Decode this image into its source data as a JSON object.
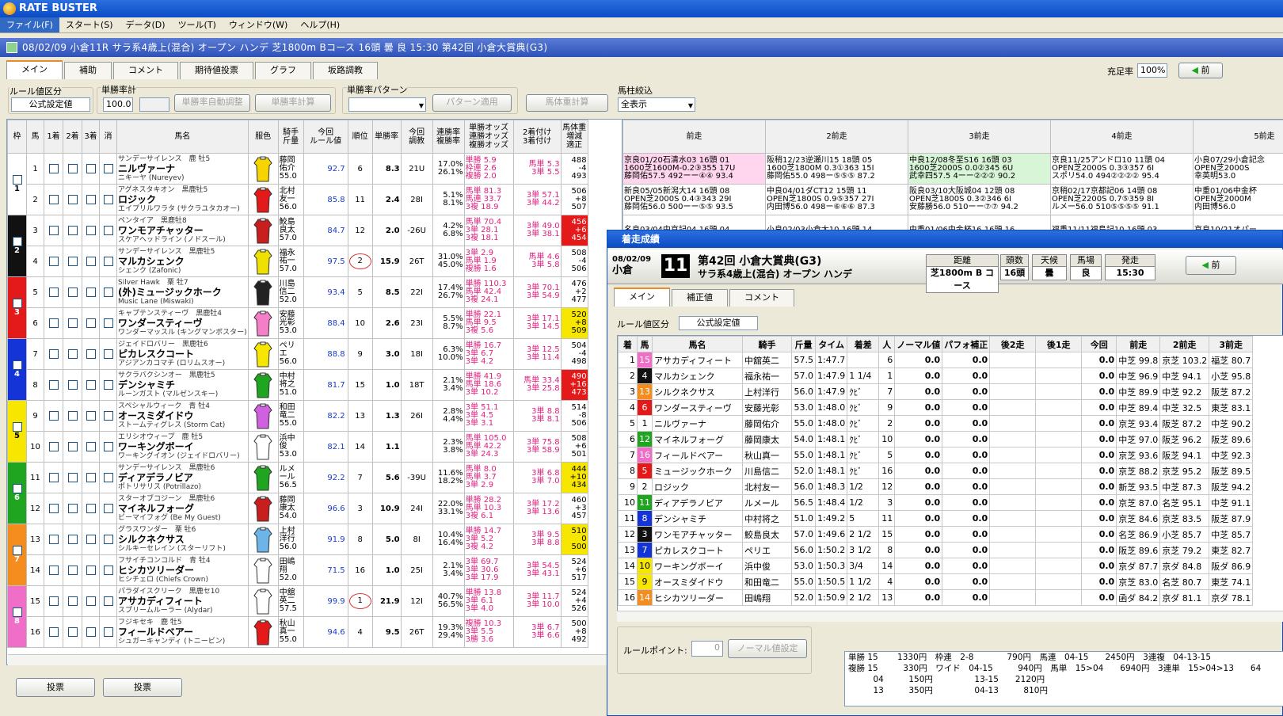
{
  "app_title": "RATE BUSTER",
  "menu": [
    "ファイル(F)",
    "スタート(S)",
    "データ(D)",
    "ツール(T)",
    "ウィンドウ(W)",
    "ヘルプ(H)"
  ],
  "race_header": "08/02/09 小倉11R サラ系4歳上(混合) オープン ハンデ 芝1800m Bコース 16頭 曇 良 15:30 第42回 小倉大賞典(G3)",
  "tabs": [
    "メイン",
    "補助",
    "コメント",
    "期待値投票",
    "グラフ",
    "坂路調教"
  ],
  "top_right": {
    "label": "充足率",
    "value": "100%",
    "prev": "前"
  },
  "controls": {
    "rule_label": "ルール値区分",
    "rule_value": "公式設定値",
    "win_rate_label": "単勝率計",
    "win_rate_value": "100.0",
    "auto_adjust": "単勝率自動調整",
    "calc": "単勝率計算",
    "pattern_label": "単勝率パターン",
    "pattern_apply": "パターン適用",
    "weight_calc": "馬体重計算",
    "filter_label": "馬柱絞込",
    "filter_value": "全表示"
  },
  "headers": [
    "枠",
    "馬",
    "1着",
    "2着",
    "3着",
    "消",
    "馬名",
    "服色",
    "騎手\n斤量",
    "今回\nルール値",
    "順位",
    "単勝率",
    "今回\n調教",
    "連勝率\n複勝率",
    "単勝オッズ\n連勝オッズ\n複勝オッズ",
    "2着付け\n3着付け",
    "馬体重\n増減\n適正",
    "前走",
    "2前走",
    "3前走",
    "4前走",
    "5前走"
  ],
  "horses": [
    {
      "frame": "1",
      "fcolor": "#ffffff",
      "fc": "#000",
      "no": "1",
      "sire": "サンデーサイレンス　鹿 牡5",
      "name": "ニルヴァーナ",
      "dam": "ニキーヤ (Nureyev)",
      "jockey": "藤岡\n佑介\n55.0",
      "rate": "92.7",
      "rank": "6",
      "odds": "8.3",
      "train": "21U",
      "pct": "17.0%\n26.1%",
      "bet": "単勝 5.9\n枠連 2.6\n複勝 2.0",
      "two": "馬単 5.3\n3単 5.5",
      "wt": "488\n-4\n493",
      "p1": "京良01/20石清水03 16頭 01\n1600芝1600M-0.2③355 17U\n藤岡佑57.5 492ーー④④ 93.4",
      "p1c": "#ffd6ee",
      "p2": "阪稍12/23逆瀬川15 18頭 05\n1600芝1800M 0.3①363 15I\n藤岡佑55.0 498ー⑤⑤⑤ 87.2",
      "p3": "中良12/08冬至S16 16頭 03\n1600芝2000S 0.0②345 6U\n武幸四57.5 4ーー②②② 90.2",
      "p3c": "#d8f5d8",
      "p4": "京良11/25アンドロ10 11頭 04\nOPEN芝2000S 0.3③357 6I\nスポリ54.0 494②②②② 95.4",
      "p5": "小良07/29小倉記念\nOPEN芝2000S\n幸英明53.0"
    },
    {
      "frame": "",
      "fcolor": "#ffffff",
      "fc": "#000",
      "no": "2",
      "sire": "アグネスタキオン　黒鹿牡5",
      "name": "ロジック",
      "dam": "エイプリルワラタ (サクラユタカオー)",
      "jockey": "北村\n友一\n56.0",
      "rate": "85.8",
      "rank": "11",
      "odds": "2.4",
      "train": "28I",
      "pct": "5.1%\n8.1%",
      "bet": "馬単 81.3\n馬連 33.7\n3複 18.9",
      "two": "3単 57.1\n3単 44.2",
      "wt": "506\n+8\n507",
      "p1": "新良05/05新潟大14 16頭 08\nOPEN芝2000S 0.4③343 29I\n藤岡佑56.0 500ーー⑤⑤ 93.5",
      "p1c": "#fff",
      "p2": "中良04/01ダCT12 15頭 11\nOPEN芝1800S 0.9⑤357 27I\n内田博56.0 498ー⑥⑥⑥ 87.3",
      "p3": "阪良03/10大阪城04 12頭 08\nOPEN芝1800S 0.3②346 6I\n安藤勝56.0 510ーー⑦⑦ 94.2",
      "p3c": "#fff",
      "p4": "京稍02/17京都記06 14頭 08\nOPEN芝2200S 0.7⑤359 8I\nルメー56.0 510⑤⑤⑤⑤ 91.1",
      "p5": "中重01/06中金杯\nOPEN芝2000M\n内田博56.0"
    },
    {
      "frame": "2",
      "fcolor": "#111111",
      "fc": "#fff",
      "no": "3",
      "sire": "ペンタイア　黒鹿牡8",
      "name": "ワンモアチャッター",
      "dam": "スケアヘッドライン (ノドスール)",
      "jockey": "鮫島\n良太\n57.0",
      "rate": "84.7",
      "rank": "12",
      "odds": "2.0",
      "train": "-26U",
      "pct": "4.2%\n6.8%",
      "bet": "馬単 70.4\n3単 28.1\n3複 18.1",
      "two": "3単 49.0\n3単 38.1",
      "wt": "456\n+6\n454",
      "p1": "名良03/04中京記04 16頭 04",
      "p1c": "#fff",
      "p2": "小良02/03小倉大10 16頭 14",
      "p3": "中重01/06中金杯16 16頭 16",
      "p3c": "#fff",
      "p4": "福重11/11福島記10 16頭 03",
      "p5": "京良10/21オパー"
    },
    {
      "frame": "",
      "fcolor": "#111111",
      "fc": "#fff",
      "no": "4",
      "sire": "サンデーサイレンス　黒鹿牡5",
      "name": "マルカシェンク",
      "dam": "シェンク (Zafonic)",
      "jockey": "福永\n祐一\n57.0",
      "rate": "97.5",
      "rank": "2",
      "odds": "15.9",
      "train": "26T",
      "pct": "31.0%\n45.0%",
      "bet": "3単 2.9\n馬単 1.9\n複勝 1.6",
      "two": "馬単 4.6\n3単 5.8",
      "wt": "508\n-4\n506",
      "p1": "",
      "p1c": "#fff",
      "p2": "",
      "p3": "",
      "p3c": "#fff",
      "p4": "",
      "p5": ""
    },
    {
      "frame": "3",
      "fcolor": "#e41a1a",
      "fc": "#fff",
      "no": "5",
      "sire": "Silver Hawk　栗 牡7",
      "name": "(外)ミュージックホーク",
      "dam": "Music Lane (Miswaki)",
      "jockey": "川島\n信二\n52.0",
      "rate": "93.4",
      "rank": "5",
      "odds": "8.5",
      "train": "22I",
      "pct": "17.4%\n26.7%",
      "bet": "単勝 110.3\n馬単 42.4\n3複 24.1",
      "two": "3単 70.1\n3単 54.9",
      "wt": "476\n+2\n477",
      "p1": "",
      "p1c": "#fff",
      "p2": "",
      "p3": "",
      "p3c": "#fff",
      "p4": "",
      "p5": ""
    },
    {
      "frame": "",
      "fcolor": "#e41a1a",
      "fc": "#fff",
      "no": "6",
      "sire": "キャプテンスティーヴ　黒鹿牡4",
      "name": "ワンダースティーヴ",
      "dam": "ワンダーマッスル (キングマンボスター)",
      "jockey": "安藤\n光彰\n53.0",
      "rate": "88.4",
      "rank": "10",
      "odds": "2.6",
      "train": "23I",
      "pct": "5.5%\n8.7%",
      "bet": "単勝 22.1\n馬単 9.5\n3複 5.6",
      "two": "3単 17.1\n3単 14.5",
      "wt": "520\n+8\n509",
      "p1": "",
      "p1c": "#fff",
      "p2": "",
      "p3": "",
      "p3c": "#fff",
      "p4": "",
      "p5": ""
    },
    {
      "frame": "4",
      "fcolor": "#1534d8",
      "fc": "#fff",
      "no": "7",
      "sire": "ジェイドロバリー　黒鹿牡6",
      "name": "ピカレスクコート",
      "dam": "アジアンカコマチ (ロリムスオー)",
      "jockey": "ペリ\nエ\n56.0",
      "rate": "88.8",
      "rank": "9",
      "odds": "3.0",
      "train": "18I",
      "pct": "6.3%\n10.0%",
      "bet": "単勝 16.7\n3単 6.7\n3単 4.2",
      "two": "3単 12.5\n3単 11.4",
      "wt": "504\n-4\n498",
      "p1": "",
      "p1c": "#fff",
      "p2": "",
      "p3": "",
      "p3c": "#fff",
      "p4": "",
      "p5": ""
    },
    {
      "frame": "",
      "fcolor": "#1534d8",
      "fc": "#fff",
      "no": "8",
      "sire": "サクラバクシンオー　黒鹿牡5",
      "name": "デンシャミチ",
      "dam": "ルーンガスト (マルゼンスキー)",
      "jockey": "中村\n将之\n51.0",
      "rate": "81.7",
      "rank": "15",
      "odds": "1.0",
      "train": "18T",
      "pct": "2.1%\n3.4%",
      "bet": "単勝 41.9\n馬単 18.6\n3単 10.2",
      "two": "馬単 33.4\n3単 25.8",
      "wt": "490\n+16\n473",
      "p1": "",
      "p1c": "#fff",
      "p2": "",
      "p3": "",
      "p3c": "#fff",
      "p4": "",
      "p5": ""
    },
    {
      "frame": "5",
      "fcolor": "#f7e600",
      "fc": "#000",
      "no": "9",
      "sire": "スペシャルウィーク　青 牡4",
      "name": "オースミダイドウ",
      "dam": "ストームティグレス (Storm Cat)",
      "jockey": "和田\n竜二\n55.0",
      "rate": "82.2",
      "rank": "13",
      "odds": "1.3",
      "train": "26I",
      "pct": "2.8%\n4.4%",
      "bet": "3単 51.1\n3単 4.5\n3単 3.1",
      "two": "3単 8.8\n3単 8.1",
      "wt": "514\n-8\n506",
      "p1": "",
      "p1c": "#fff",
      "p2": "",
      "p3": "",
      "p3c": "#fff",
      "p4": "",
      "p5": ""
    },
    {
      "frame": "",
      "fcolor": "#f7e600",
      "fc": "#000",
      "no": "10",
      "sire": "エリシオウィープ　鹿 牡5",
      "name": "ワーキングボーイ",
      "dam": "ワーキングイオン (ジェイドロバリー)",
      "jockey": "浜中\n俊\n53.0",
      "rate": "82.1",
      "rank": "14",
      "odds": "1.1",
      "train": "",
      "pct": "2.3%\n3.8%",
      "bet": "馬単 105.0\n馬単 42.2\n3単 24.3",
      "two": "3単 75.8\n3単 58.9",
      "wt": "508\n+6\n501",
      "p1": "",
      "p1c": "#fff",
      "p2": "",
      "p3": "",
      "p3c": "#fff",
      "p4": "",
      "p5": ""
    },
    {
      "frame": "6",
      "fcolor": "#1fa51f",
      "fc": "#fff",
      "no": "11",
      "sire": "サンデーサイレンス　黒鹿牡6",
      "name": "ディアデラノビア",
      "dam": "ポトリサリス (Potrillazo)",
      "jockey": "ルメ\nール\n56.5",
      "rate": "92.2",
      "rank": "7",
      "odds": "5.6",
      "train": "-39U",
      "pct": "11.6%\n18.2%",
      "bet": "馬単 8.0\n馬単 3.7\n3単 2.9",
      "two": "3単 6.8\n3単 7.0",
      "wt": "444\n+10\n434",
      "p1": "",
      "p1c": "#fff",
      "p2": "",
      "p3": "",
      "p3c": "#fff",
      "p4": "",
      "p5": ""
    },
    {
      "frame": "",
      "fcolor": "#1fa51f",
      "fc": "#fff",
      "no": "12",
      "sire": "スターオブコジーン　黒鹿牡6",
      "name": "マイネルフォーグ",
      "dam": "ビーマイフォグ (Be My Guest)",
      "jockey": "藤岡\n康太\n54.0",
      "rate": "96.6",
      "rank": "3",
      "odds": "10.9",
      "train": "24I",
      "pct": "22.0%\n33.1%",
      "bet": "単勝 28.2\n馬単 10.3\n3複 6.1",
      "two": "3単 17.2\n3単 13.6",
      "wt": "460\n+3\n457",
      "p1": "",
      "p1c": "#fff",
      "p2": "",
      "p3": "",
      "p3c": "#fff",
      "p4": "",
      "p5": ""
    },
    {
      "frame": "7",
      "fcolor": "#f58c1e",
      "fc": "#fff",
      "no": "13",
      "sire": "グラスワンダー　栗 牡6",
      "name": "シルクネクサス",
      "dam": "シルキーセレイン (スターリフト)",
      "jockey": "上村\n洋行\n56.0",
      "rate": "91.9",
      "rank": "8",
      "odds": "5.0",
      "train": "8I",
      "pct": "10.4%\n16.4%",
      "bet": "単勝 14.7\n3単 5.2\n3複 4.2",
      "two": "3単 9.5\n3単 8.8",
      "wt": "510\n0\n500",
      "p1": "",
      "p1c": "#fff",
      "p2": "",
      "p3": "",
      "p3c": "#fff",
      "p4": "",
      "p5": ""
    },
    {
      "frame": "",
      "fcolor": "#f58c1e",
      "fc": "#fff",
      "no": "14",
      "sire": "フサイチコンコルド　青 牡4",
      "name": "ヒシカツリーダー",
      "dam": "ヒシチェロ (Chiefs Crown)",
      "jockey": "田嶋\n翔\n52.0",
      "rate": "71.5",
      "rank": "16",
      "odds": "1.0",
      "train": "25I",
      "pct": "2.1%\n3.4%",
      "bet": "3単 69.7\n3単 30.6\n3単 17.9",
      "two": "3単 54.5\n3単 43.1",
      "wt": "524\n+6\n517",
      "p1": "",
      "p1c": "#fff",
      "p2": "",
      "p3": "",
      "p3c": "#fff",
      "p4": "",
      "p5": ""
    },
    {
      "frame": "8",
      "fcolor": "#f06ec8",
      "fc": "#fff",
      "no": "15",
      "sire": "パラダイスクリーク　黒鹿セ10",
      "name": "アサカディフィート",
      "dam": "スプリームルーラー (Alydar)",
      "jockey": "中舘\n英二\n57.5",
      "rate": "99.9",
      "rank": "1",
      "odds": "21.9",
      "train": "12I",
      "pct": "40.7%\n56.5%",
      "bet": "単勝 13.8\n3単 6.1\n3単 4.0",
      "two": "3単 11.7\n3単 10.0",
      "wt": "524\n+4\n526",
      "p1": "",
      "p1c": "#fff",
      "p2": "",
      "p3": "",
      "p3c": "#fff",
      "p4": "",
      "p5": ""
    },
    {
      "frame": "",
      "fcolor": "#f06ec8",
      "fc": "#fff",
      "no": "16",
      "sire": "フジキセキ　鹿 牡5",
      "name": "フィールドベアー",
      "dam": "シュガーキャンディ (トニービン)",
      "jockey": "秋山\n真一\n55.0",
      "rate": "94.6",
      "rank": "4",
      "odds": "9.5",
      "train": "26T",
      "pct": "19.3%\n29.4%",
      "bet": "複勝 10.3\n3単 5.5\n3勝 3.6",
      "two": "3単 6.7\n3単 6.6",
      "wt": "500\n+8\n492",
      "p1": "",
      "p1c": "#fff",
      "p2": "",
      "p3": "",
      "p3c": "#fff",
      "p4": "",
      "p5": ""
    }
  ],
  "bottom_buttons": [
    "投票",
    "投票"
  ],
  "overlay": {
    "title": "着走成績",
    "date": "08/02/09",
    "course": "小倉",
    "race_no": "11",
    "race_name": "第42回 小倉大賞典(G3)",
    "race_cond": "サラ系4歳上(混合) オープン ハンデ",
    "info": [
      {
        "h": "距離",
        "v": "芝1800m B コース"
      },
      {
        "h": "頭数",
        "v": "16頭"
      },
      {
        "h": "天候",
        "v": "曇"
      },
      {
        "h": "馬場",
        "v": "良"
      },
      {
        "h": "発走",
        "v": "15:30"
      }
    ],
    "prev": "前",
    "tabs": [
      "メイン",
      "補正値",
      "コメント"
    ],
    "rule_label": "ルール値区分",
    "rule_value": "公式設定値",
    "cols": [
      "着",
      "馬",
      "馬名",
      "騎手",
      "斤量",
      "タイム",
      "着差",
      "人",
      "ノーマル値",
      "パフォ補正",
      "後2走",
      "後1走",
      "今回",
      "前走",
      "2前走",
      "3前走"
    ],
    "rows": [
      [
        "1",
        "15",
        "アサカディフィート",
        "中舘英二",
        "57.5",
        "1:47.7",
        "",
        "6",
        "0.0",
        "0.0",
        "",
        "",
        "0.0",
        "中芝 99.8",
        "京芝 103.2",
        "福芝 80.7"
      ],
      [
        "2",
        "4",
        "マルカシェンク",
        "福永祐一",
        "57.0",
        "1:47.9",
        "1 1/4",
        "1",
        "0.0",
        "0.0",
        "",
        "",
        "0.0",
        "中芝 96.9",
        "中芝 94.1",
        "小芝 95.8"
      ],
      [
        "3",
        "13",
        "シルクネクサス",
        "上村洋行",
        "56.0",
        "1:47.9",
        "ｸﾋﾞ",
        "7",
        "0.0",
        "0.0",
        "",
        "",
        "0.0",
        "中芝 89.9",
        "中芝 92.2",
        "阪芝 87.2"
      ],
      [
        "4",
        "6",
        "ワンダースティーヴ",
        "安藤光彰",
        "53.0",
        "1:48.0",
        "ｸﾋﾞ",
        "9",
        "0.0",
        "0.0",
        "",
        "",
        "0.0",
        "中芝 89.4",
        "中芝 32.5",
        "東芝 83.1"
      ],
      [
        "5",
        "1",
        "ニルヴァーナ",
        "藤岡佑介",
        "55.0",
        "1:48.0",
        "ｸﾋﾞ",
        "2",
        "0.0",
        "0.0",
        "",
        "",
        "0.0",
        "京芝 93.4",
        "阪芝 87.2",
        "中芝 90.2"
      ],
      [
        "6",
        "12",
        "マイネルフォーグ",
        "藤岡康太",
        "54.0",
        "1:48.1",
        "ｸﾋﾞ",
        "10",
        "0.0",
        "0.0",
        "",
        "",
        "0.0",
        "中芝 97.0",
        "阪芝 96.2",
        "阪芝 89.6"
      ],
      [
        "7",
        "16",
        "フィールドベアー",
        "秋山真一",
        "55.0",
        "1:48.1",
        "ｸﾋﾞ",
        "5",
        "0.0",
        "0.0",
        "",
        "",
        "0.0",
        "京芝 93.6",
        "阪芝 94.1",
        "中芝 92.3"
      ],
      [
        "8",
        "5",
        "ミュージックホーク",
        "川島信二",
        "52.0",
        "1:48.1",
        "ｸﾋﾞ",
        "16",
        "0.0",
        "0.0",
        "",
        "",
        "0.0",
        "京芝 88.2",
        "京芝 95.2",
        "阪芝 89.5"
      ],
      [
        "9",
        "2",
        "ロジック",
        "北村友一",
        "56.0",
        "1:48.3",
        "1/2",
        "12",
        "0.0",
        "0.0",
        "",
        "",
        "0.0",
        "新芝 93.5",
        "中芝 87.3",
        "阪芝 94.2"
      ],
      [
        "10",
        "11",
        "ディアデラノビア",
        "ルメール",
        "56.5",
        "1:48.4",
        "1/2",
        "3",
        "0.0",
        "0.0",
        "",
        "",
        "0.0",
        "京芝 87.0",
        "名芝 95.1",
        "中芝 91.1"
      ],
      [
        "11",
        "8",
        "デンシャミチ",
        "中村将之",
        "51.0",
        "1:49.2",
        "5",
        "11",
        "0.0",
        "0.0",
        "",
        "",
        "0.0",
        "京芝 84.6",
        "京芝 83.5",
        "阪芝 87.9"
      ],
      [
        "12",
        "3",
        "ワンモアチャッター",
        "鮫島良太",
        "57.0",
        "1:49.6",
        "2 1/2",
        "15",
        "0.0",
        "0.0",
        "",
        "",
        "0.0",
        "名芝 86.9",
        "小芝 85.7",
        "中芝 85.7"
      ],
      [
        "13",
        "7",
        "ピカレスクコート",
        "ペリエ",
        "56.0",
        "1:50.2",
        "3 1/2",
        "8",
        "0.0",
        "0.0",
        "",
        "",
        "0.0",
        "阪芝 89.6",
        "京芝 79.2",
        "東芝 82.7"
      ],
      [
        "14",
        "10",
        "ワーキングボーイ",
        "浜中俊",
        "53.0",
        "1:50.3",
        "3/4",
        "14",
        "0.0",
        "0.0",
        "",
        "",
        "0.0",
        "京ダ 87.7",
        "京ダ 84.8",
        "阪ダ 86.9"
      ],
      [
        "15",
        "9",
        "オースミダイドウ",
        "和田竜二",
        "55.0",
        "1:50.5",
        "1 1/2",
        "4",
        "0.0",
        "0.0",
        "",
        "",
        "0.0",
        "京芝 83.0",
        "名芝 80.7",
        "東芝 74.1"
      ],
      [
        "16",
        "14",
        "ヒシカツリーダー",
        "田嶋翔",
        "52.0",
        "1:50.9",
        "2 1/2",
        "13",
        "0.0",
        "0.0",
        "",
        "",
        "0.0",
        "函ダ 84.2",
        "京ダ 81.1",
        "京ダ 78.1"
      ]
    ],
    "rule_point_label": "ルールポイント:",
    "rule_point_value": "0",
    "normal_set": "ノーマル値設定",
    "payout": [
      "単勝 15　　 1330円　枠連　2-8　　　　790円　馬連　04-15　　2450円　3連複　04-13-15",
      "複勝 15　　　330円　ワイド　04-15　　　940円　馬単　15>04　　6940円　3連単　15>04>13　　64",
      "　　　04　　　150円　　　　　13-15　　2120円",
      "　　　13　　　350円　　　　　04-13　　　810円"
    ]
  },
  "frame_colors": {
    "1": "#ffffff",
    "2": "#111111",
    "3": "#e41a1a",
    "4": "#1534d8",
    "5": "#f7e600",
    "6": "#1fa51f",
    "7": "#f58c1e",
    "8": "#f06ec8"
  }
}
